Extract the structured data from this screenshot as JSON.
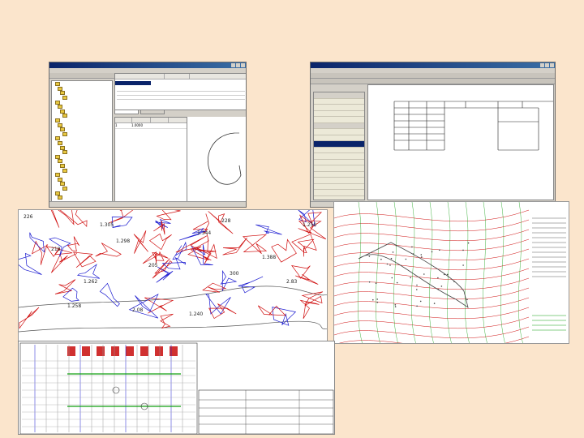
{
  "colors": {
    "background": "#fbe5cc",
    "window_chrome": "#d4d0c8",
    "titlebar": "#0a246a",
    "selection": "#0a246a",
    "map_red": "#d01010",
    "map_blue": "#1a1ad0",
    "map_green": "#10a010"
  },
  "screens": {
    "tree_editor": {
      "tree_items": [
        "",
        "",
        "",
        "",
        "",
        "",
        "",
        "",
        "",
        "",
        "",
        "",
        "",
        "",
        "",
        "",
        "",
        "",
        "",
        "",
        "",
        "",
        "",
        "",
        "",
        ""
      ],
      "props_header": [
        "",
        "",
        ""
      ],
      "sub_tabs": [
        "",
        ""
      ],
      "table_header": [
        "",
        "",
        "",
        ""
      ],
      "table_row_values": [
        "1",
        "1.0000"
      ],
      "status_text": ""
    },
    "table_designer": {
      "menu_text": "",
      "panel_rows": [
        "",
        "",
        "",
        "",
        "",
        "",
        "",
        "",
        "",
        "",
        "",
        "",
        "",
        "",
        "",
        "",
        "",
        "",
        ""
      ],
      "status_text": ""
    },
    "cadastral_map": {
      "labels": [
        "226",
        "218",
        "1.298",
        "1.344",
        "1.388",
        "1.262",
        "205",
        "1.240",
        "2.83",
        "300",
        "2.08",
        "1.258",
        "1.250",
        "1.305",
        "228"
      ]
    },
    "engineering_plan": {
      "legend_lines": [
        "",
        "",
        "",
        "",
        "",
        "",
        "",
        "",
        "",
        "",
        "",
        "",
        ""
      ],
      "legend_green": [
        "",
        "",
        "",
        ""
      ]
    },
    "profile_drawing": {
      "stamp_rows": [
        "",
        "",
        "",
        ""
      ]
    }
  }
}
